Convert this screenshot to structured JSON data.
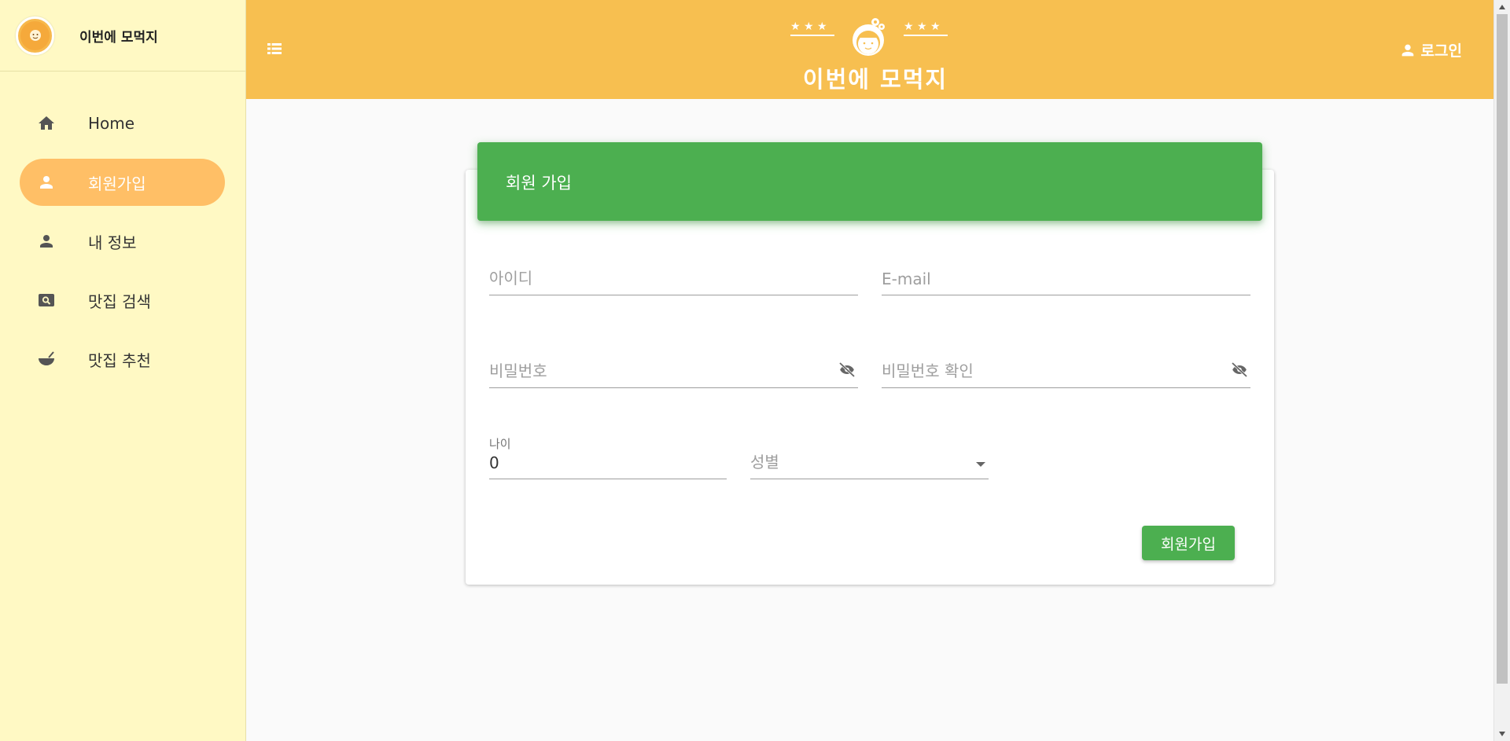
{
  "sidebar": {
    "title": "이번에 모먹지",
    "items": [
      {
        "label": "Home",
        "icon": "home-icon"
      },
      {
        "label": "회원가입",
        "icon": "person-icon",
        "active": true
      },
      {
        "label": "내 정보",
        "icon": "person-icon"
      },
      {
        "label": "맛집 검색",
        "icon": "search-box-icon"
      },
      {
        "label": "맛집 추천",
        "icon": "bowl-icon"
      }
    ]
  },
  "header": {
    "brand_title": "이번에 모먹지",
    "login_label": "로그인"
  },
  "form": {
    "title": "회원 가입",
    "id_placeholder": "아이디",
    "email_placeholder": "E-mail",
    "password_placeholder": "비밀번호",
    "password_confirm_placeholder": "비밀번호 확인",
    "age_label": "나이",
    "age_value": "0",
    "gender_placeholder": "성별",
    "submit_label": "회원가입"
  },
  "colors": {
    "sidebar_bg": "#fff9c4",
    "topbar_bg": "#f7bf50",
    "active_item": "#ffbf66",
    "accent_green": "#4caf50"
  }
}
